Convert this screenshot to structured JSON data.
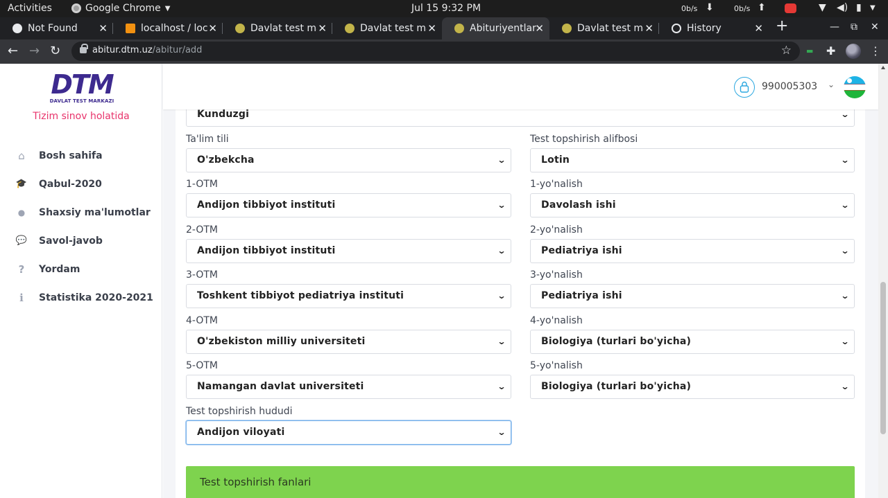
{
  "system": {
    "activities": "Activities",
    "app_menu": "Google Chrome",
    "clock": "Jul 15  9:32 PM",
    "net_down": "0b/s",
    "net_up": "0b/s"
  },
  "browser": {
    "tabs": [
      {
        "title": "Not Found",
        "favicon_color": "#e8eaed",
        "active": false
      },
      {
        "title": "localhost / localhost",
        "favicon_color": "#f29111",
        "active": false
      },
      {
        "title": "Davlat test markazi",
        "favicon_color": "#c2b44a",
        "active": false
      },
      {
        "title": "Davlat test markazi",
        "favicon_color": "#c2b44a",
        "active": false
      },
      {
        "title": "Abituriyentlarni ro'yxatga olish",
        "favicon_color": "#c2b44a",
        "active": true
      },
      {
        "title": "Davlat test markazi",
        "favicon_color": "#c2b44a",
        "active": false
      },
      {
        "title": "History",
        "favicon_color": "#e8eaed",
        "active": false
      }
    ],
    "url_host": "abitur.dtm.uz",
    "url_path": "/abitur/add"
  },
  "sidebar": {
    "logo_text": "DTM",
    "logo_subtitle": "DAVLAT TEST MARKAZI",
    "status_note": "Tizim sinov holatida",
    "items": [
      {
        "label": "Bosh sahifa",
        "icon": "home-icon",
        "glyph": "⌂"
      },
      {
        "label": "Qabul-2020",
        "icon": "graduation-cap-icon",
        "glyph": "🎓"
      },
      {
        "label": "Shaxsiy ma'lumotlar",
        "icon": "user-icon",
        "glyph": "●"
      },
      {
        "label": "Savol-javob",
        "icon": "chat-icon",
        "glyph": "💬"
      },
      {
        "label": "Yordam",
        "icon": "question-icon",
        "glyph": "?"
      },
      {
        "label": "Statistika 2020-2021",
        "icon": "info-icon",
        "glyph": "i"
      }
    ]
  },
  "header": {
    "username": "990005303",
    "flag_colors": {
      "blue": "#1eb3e6",
      "white": "#ffffff",
      "green": "#1eb53a",
      "red": "#dd2222"
    }
  },
  "form": {
    "study_form": {
      "value": "Kunduzgi"
    },
    "education_language": {
      "label": "Ta'lim tili",
      "value": "O'zbekcha"
    },
    "test_alphabet": {
      "label": "Test topshirish alifbosi",
      "value": "Lotin"
    },
    "choices": [
      {
        "otm_label": "1-OTM",
        "otm": "Andijon tibbiyot instituti",
        "dir_label": "1-yo'nalish",
        "direction": "Davolash ishi"
      },
      {
        "otm_label": "2-OTM",
        "otm": "Andijon tibbiyot instituti",
        "dir_label": "2-yo'nalish",
        "direction": "Pediatriya ishi"
      },
      {
        "otm_label": "3-OTM",
        "otm": "Toshkent tibbiyot pediatriya instituti",
        "dir_label": "3-yo'nalish",
        "direction": "Pediatriya ishi"
      },
      {
        "otm_label": "4-OTM",
        "otm": "O'zbekiston milliy universiteti",
        "dir_label": "4-yo'nalish",
        "direction": "Biologiya (turlari bo'yicha)"
      },
      {
        "otm_label": "5-OTM",
        "otm": "Namangan davlat universiteti",
        "dir_label": "5-yo'nalish",
        "direction": "Biologiya (turlari bo'yicha)"
      }
    ],
    "test_region": {
      "label": "Test topshirish hududi",
      "value": "Andijon viloyati"
    },
    "subjects_header": "Test topshirish fanlari"
  },
  "colors": {
    "accent_blue": "#2aa7e0",
    "brand_purple": "#3d2a8f",
    "status_pink": "#e8336b",
    "success_green": "#7ed34e"
  }
}
